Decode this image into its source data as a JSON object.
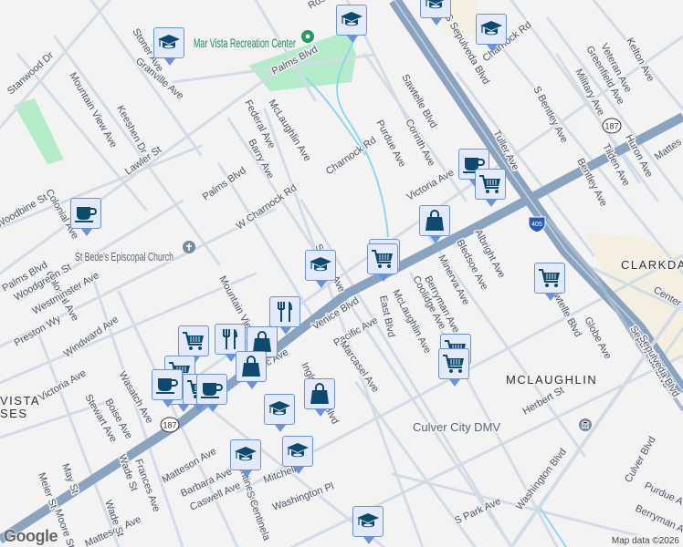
{
  "colors": {
    "highway": "#8aa3be",
    "road": "#d3dce6",
    "park": "#b4ebc9",
    "water": "#8fd8ec",
    "marker_fill": "#e2eafb",
    "marker_border": "#6d92d8",
    "icon": "#0d4a6e"
  },
  "places": {
    "park": "Mar Vista Recreation Center",
    "church": "St Bede's Episcopal Church",
    "dmv": "Culver City DMV",
    "area1": "MCLAUGHLIN",
    "area2": "CLARKDALE",
    "area3": "VISTA",
    "area4": "SES"
  },
  "shields": {
    "ca187a": "187",
    "ca187b": "187",
    "i405": "405"
  },
  "street_labels": [
    "Palms Blvd",
    "McLaughlin Ave",
    "Stoner Ave",
    "Granville Ave",
    "Stanwood Dr",
    "Mountain View Ave",
    "Keeshen Dr",
    "Lawler St",
    "Federal Ave",
    "Barry Ave",
    "Charnock Rd",
    "W Charnock Rd",
    "Sawtelle Blvd",
    "Purdue Ave",
    "Corinth Ave",
    "Victoria Ave",
    "S Sepulveda Blvd",
    "Charnock Rd",
    "S Bentley Ave",
    "Military Ave",
    "Greenfield Ave",
    "Veteran Ave",
    "Kelton Ave",
    "Tuller Ave",
    "Huron Ave",
    "Mattes",
    "Tilden Ave",
    "Bentley Ave",
    "Albright Ave",
    "Bledsoe Ave",
    "Minerva Ave",
    "Berryman Ave",
    "Coolidge Ave",
    "East Blvd",
    "McLaughlin Ave",
    "Pacific Ave",
    "Marcasel Ave",
    "Venice Blvd",
    "Inglewood Blvd",
    "Sepulveda Blvd",
    "Sawtelle Blvd",
    "Center St",
    "Globe Ave",
    "Herbert St",
    "Washington Blvd",
    "Culver Blvd",
    "Purdue Ave",
    "Berryman Ave",
    "S Park Ave",
    "Washington Pl",
    "Mitchell",
    "Caswell Ave",
    "Barbara Ave",
    "Matteson Ave",
    "Matteson Ave",
    "S Centinela Ave",
    "S Centinela",
    "Frances Ave",
    "Wade St",
    "Wade St",
    "Meier St",
    "May St",
    "Moore St",
    "Boise Ave",
    "Stewart Ave",
    "Wasatch Ave",
    "Colonial Ave",
    "Victoria Ave",
    "Windward Ave",
    "Westminster Ave",
    "Woodgreen St",
    "Palms Blvd",
    "Preston Wy",
    "Woodbine St",
    "Colonial Ave",
    "Mountain View",
    "S Barry Ave",
    "Pacific Ave",
    "Palms Blvd",
    "Rose Ave",
    "Sepulveda Blvd"
  ],
  "pois": [
    {
      "type": "school"
    },
    {
      "type": "school"
    },
    {
      "type": "school"
    },
    {
      "type": "school"
    },
    {
      "type": "school"
    },
    {
      "type": "school"
    },
    {
      "type": "school"
    },
    {
      "type": "school"
    },
    {
      "type": "school"
    },
    {
      "type": "cafe"
    },
    {
      "type": "cafe"
    },
    {
      "type": "cart"
    },
    {
      "type": "cart"
    },
    {
      "type": "cart"
    },
    {
      "type": "cart"
    },
    {
      "type": "cart"
    },
    {
      "type": "cart"
    },
    {
      "type": "cart"
    },
    {
      "type": "cart"
    },
    {
      "type": "bag"
    },
    {
      "type": "bag"
    },
    {
      "type": "bag"
    },
    {
      "type": "restaurant"
    },
    {
      "type": "restaurant"
    },
    {
      "type": "bag"
    },
    {
      "type": "cart"
    },
    {
      "type": "cafe"
    },
    {
      "type": "cart"
    },
    {
      "type": "cafe"
    }
  ],
  "footer": {
    "logo": "Google",
    "attribution": "Map data ©2026"
  }
}
